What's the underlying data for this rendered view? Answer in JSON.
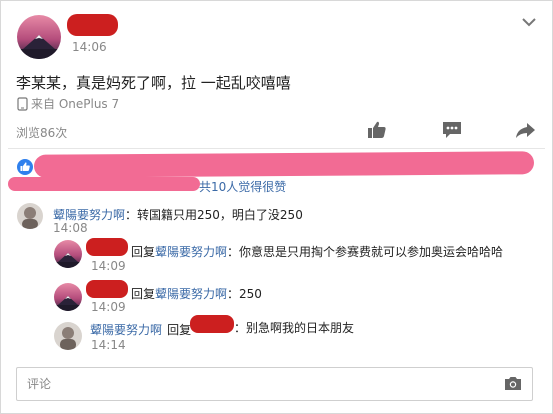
{
  "post": {
    "time": "14:06",
    "text": "李某某，真是妈死了啊，拉 一起乱咬嘻嘻",
    "device_label": "来自 OnePlus 7",
    "views": "浏览86次"
  },
  "likes": {
    "summary": "共10人觉得很赞"
  },
  "comments": [
    {
      "author": "颦陽要努力啊",
      "text": "：转国籍只用250，明白了没250",
      "time": "14:08",
      "replies": [
        {
          "reply_prefix": "回复",
          "reply_target": "颦陽要努力啊",
          "text": "：你意思是只用掏个参赛费就可以参加奥运会哈哈哈",
          "time": "14:09"
        },
        {
          "reply_prefix": "回复",
          "reply_target": "颦陽要努力啊",
          "text": "：250",
          "time": "14:09"
        },
        {
          "author": "颦陽要努力啊",
          "reply_prefix": "回复",
          "text": "：别急啊我的日本朋友",
          "time": "14:14"
        }
      ]
    }
  ],
  "composer": {
    "placeholder": "评论"
  },
  "colors": {
    "redaction": "#cc1f1f",
    "highlight": "#f26b94",
    "link": "#3b6aa7",
    "like_badge": "#2f80ed"
  },
  "icons": [
    "chevron-down-icon",
    "phone-icon",
    "thumbs-up-icon",
    "comment-icon",
    "share-icon",
    "like-badge-icon",
    "camera-icon"
  ]
}
